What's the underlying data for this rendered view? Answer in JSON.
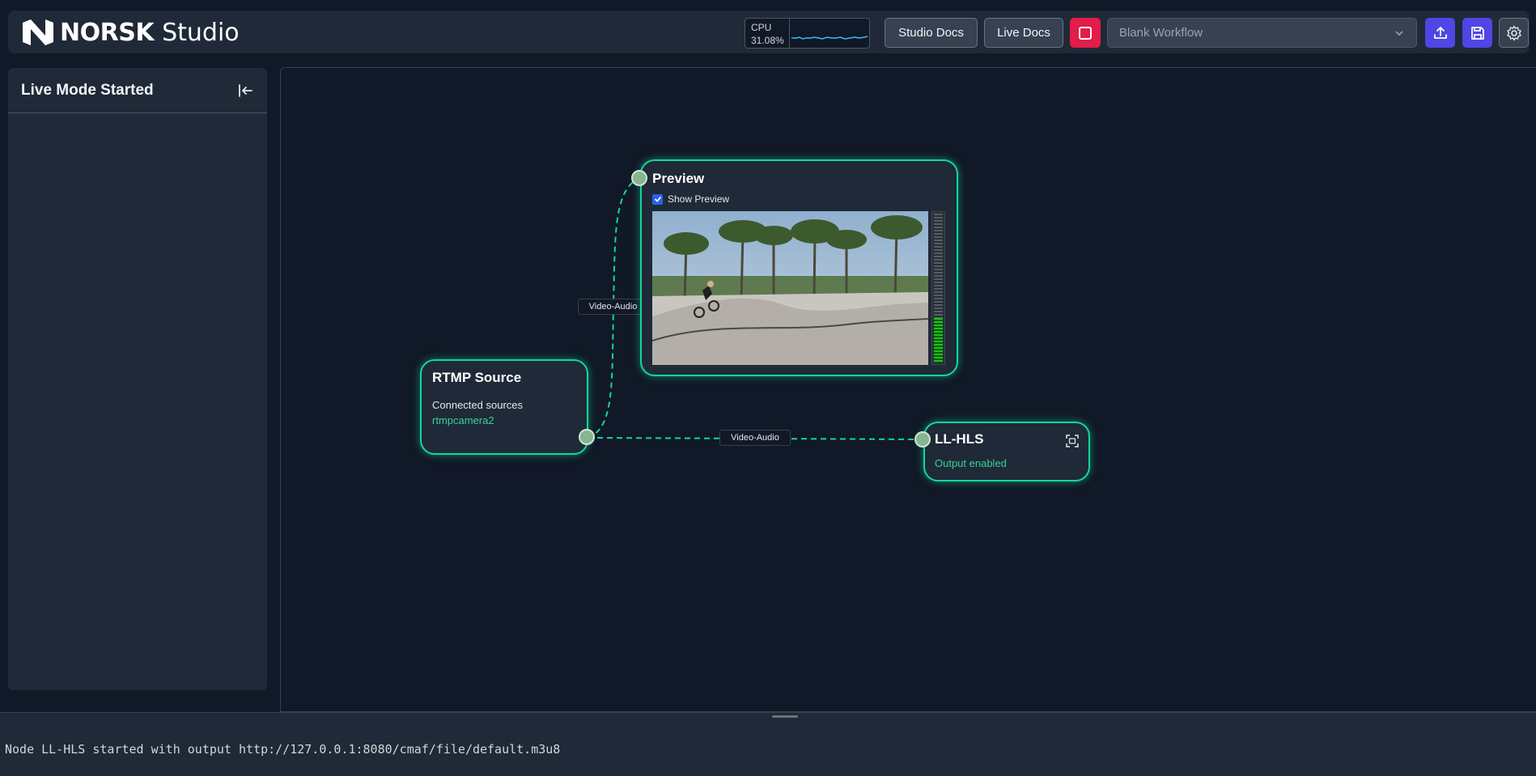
{
  "header": {
    "logo_text": "NORSK",
    "logo_product": "Studio",
    "cpu_label": "CPU",
    "cpu_value": "31.08%",
    "studio_docs_label": "Studio Docs",
    "live_docs_label": "Live Docs",
    "workflow_select_value": "Blank Workflow"
  },
  "sidebar": {
    "title": "Live Mode Started"
  },
  "nodes": {
    "rtmp": {
      "title": "RTMP Source",
      "sources_label": "Connected sources",
      "source_name": "rtmpcamera2"
    },
    "preview": {
      "title": "Preview",
      "show_preview_label": "Show Preview",
      "show_preview_checked": true
    },
    "llhls": {
      "title": "LL-HLS",
      "status": "Output enabled"
    }
  },
  "edges": [
    {
      "label": "Video-Audio"
    },
    {
      "label": "Video-Audio"
    }
  ],
  "log": {
    "message": "Node LL-HLS started with output http://127.0.0.1:8080/cmaf/file/default.m3u8"
  },
  "audio_meter_level": 0.3,
  "colors": {
    "accent": "#10d89b",
    "stop": "#e11d48",
    "primary": "#4f46e5",
    "background": "#111827",
    "panel": "#1f2937"
  },
  "icons": {
    "collapse": "collapse-sidebar-icon",
    "upload": "upload-icon",
    "save": "save-icon",
    "settings": "gear-icon",
    "stop": "stop-icon",
    "chevron": "chevron-down-icon",
    "fullscreen": "fullscreen-icon"
  }
}
